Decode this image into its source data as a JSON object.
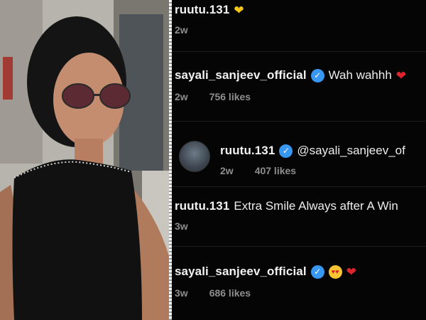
{
  "comments": [
    {
      "username": "ruutu.131",
      "text": "",
      "emoji": "yellow-heart",
      "time": "2w",
      "likes": ""
    },
    {
      "username": "sayali_sanjeev_official",
      "verified": true,
      "text": "Wah wahhh",
      "emoji": "red-heart",
      "time": "2w",
      "likes": "756 likes"
    },
    {
      "username": "ruutu.131",
      "verified": true,
      "text": "@sayali_sanjeev_of",
      "time": "2w",
      "likes": "407 likes",
      "avatar": true
    },
    {
      "username": "ruutu.131",
      "text": "Extra Smile Always after A Win",
      "time": "3w",
      "likes": ""
    },
    {
      "username": "sayali_sanjeev_official",
      "verified": true,
      "text": "",
      "emoji": "heart-eyes-and-red-heart",
      "time": "3w",
      "likes": "686 likes"
    }
  ],
  "colors": {
    "background": "#050505",
    "verified": "#3897f0",
    "meta": "#8e8e8e"
  }
}
